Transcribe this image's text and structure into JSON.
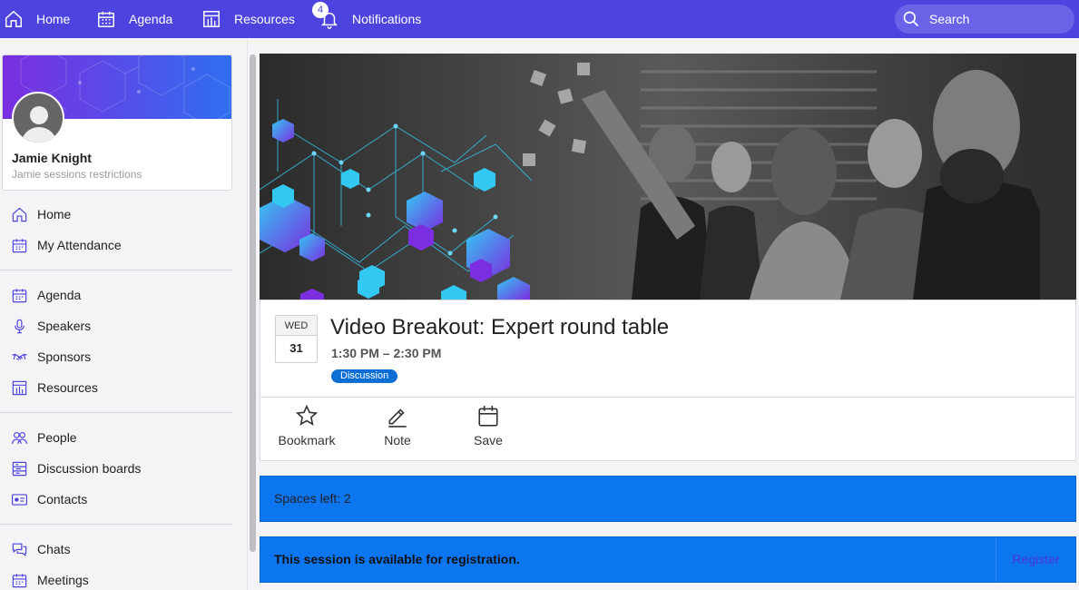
{
  "topnav": {
    "items": [
      {
        "label": "Home",
        "icon": "home-icon"
      },
      {
        "label": "Agenda",
        "icon": "calendar-icon"
      },
      {
        "label": "Resources",
        "icon": "resources-icon"
      },
      {
        "label": "Notifications",
        "icon": "bell-icon",
        "badge": "4"
      }
    ],
    "search_label": "Search",
    "background_color": "#4d44e0"
  },
  "profile": {
    "name": "Jamie Knight",
    "subtitle": "Jamie sessions restrictions"
  },
  "sidebar": {
    "groups": [
      [
        {
          "label": "Home",
          "icon": "home-icon"
        },
        {
          "label": "My Attendance",
          "icon": "calendar-icon"
        }
      ],
      [
        {
          "label": "Agenda",
          "icon": "calendar-icon"
        },
        {
          "label": "Speakers",
          "icon": "microphone-icon"
        },
        {
          "label": "Sponsors",
          "icon": "handshake-icon"
        },
        {
          "label": "Resources",
          "icon": "resources-icon"
        }
      ],
      [
        {
          "label": "People",
          "icon": "people-icon"
        },
        {
          "label": "Discussion boards",
          "icon": "board-icon"
        },
        {
          "label": "Contacts",
          "icon": "contact-card-icon"
        }
      ],
      [
        {
          "label": "Chats",
          "icon": "chat-icon"
        },
        {
          "label": "Meetings",
          "icon": "calendar-icon"
        }
      ]
    ]
  },
  "session": {
    "date_dow": "WED",
    "date_day": "31",
    "title": "Video Breakout: Expert round table",
    "time": "1:30 PM – 2:30 PM",
    "tag": "Discussion",
    "actions": [
      {
        "label": "Bookmark",
        "icon": "star-icon"
      },
      {
        "label": "Note",
        "icon": "pen-icon"
      },
      {
        "label": "Save",
        "icon": "calendar-icon"
      }
    ]
  },
  "spaces": {
    "text": "Spaces left: 2"
  },
  "registration": {
    "text": "This session is available for registration.",
    "button_label": "Register"
  },
  "colors": {
    "accent": "#4d44e0",
    "info_bar": "#0c75f0",
    "tag": "#0c6fd4"
  }
}
